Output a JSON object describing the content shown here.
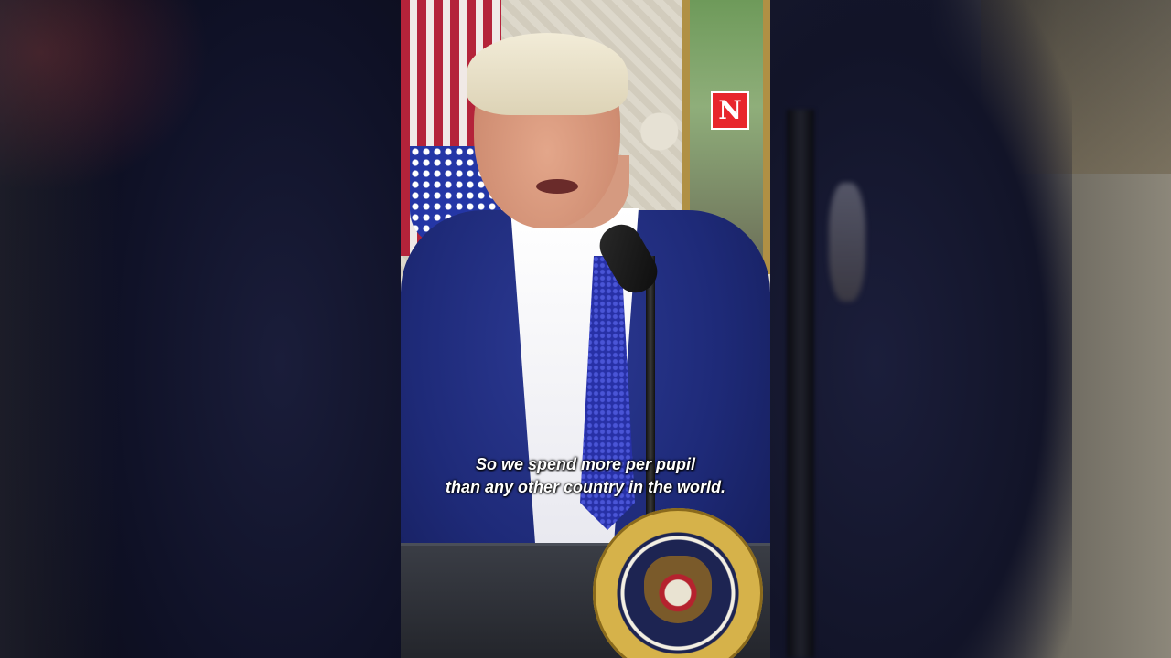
{
  "video": {
    "logo_letter": "N",
    "caption_lines": [
      "So we spend more per pupil",
      "than any other country in the world."
    ]
  },
  "colors": {
    "logo_red": "#e8262c",
    "suit_blue": "#1e2a78",
    "caption_text": "#ffffff"
  }
}
